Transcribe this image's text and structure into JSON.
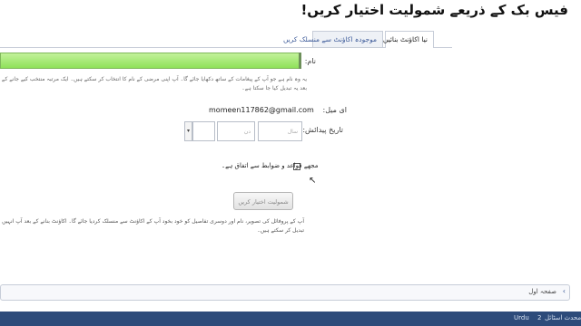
{
  "page": {
    "title": "فیس بک کے ذریعے شمولیت اختیار کریں!"
  },
  "tabs": [
    {
      "label": "نیا اکاؤنٹ بنائیں",
      "active": true
    },
    {
      "label": "موجودہ اکاؤنٹ سے منسلک کریں",
      "active": false
    }
  ],
  "form": {
    "name_label": "نام:",
    "name_hint": "یہ وہ نام ہے جو آپ کے پیغامات کے ساتھ دکھایا جائے گا۔ آپ اپنی مرضی کے نام کا انتخاب کر سکتے ہیں۔ ایک مرتبہ منتخب کیے جانے کے بعد یہ تبدیل کیا جا سکتا ہے۔",
    "email_label": "ای میل:",
    "email_value": "momeen117862@gmail.com",
    "dob_label": "تاریخ پیدائش:",
    "dob_year_placeholder": "سال",
    "dob_day_placeholder": "دن",
    "agree_label": "مجھے قواعد و ضوابط سے اتفاق ہے۔",
    "agree_checked": false,
    "join_button": "شمولیت اختیار کریں",
    "footer_text": "آپ کے پروفائل کی تصویر، نام اور دوسری تفاصیل کو خود بخود آپ کے اکاؤنٹ سے منسلک کردیا جائے گا۔ اکاؤنٹ بنانے کے بعد آپ انہیں تبدیل کر سکتے ہیں۔"
  },
  "pager": {
    "label": "صفحہ اول",
    "arrow_icon": "chevron-left-icon"
  },
  "bottom_bar": {
    "left_text": "Urdu",
    "number_text": "2",
    "right_text": "محدث اسٹائل"
  },
  "colors": {
    "name_bar": "#8fe25a",
    "bottom_bar": "#2d4b7a",
    "link": "#3b5998"
  }
}
